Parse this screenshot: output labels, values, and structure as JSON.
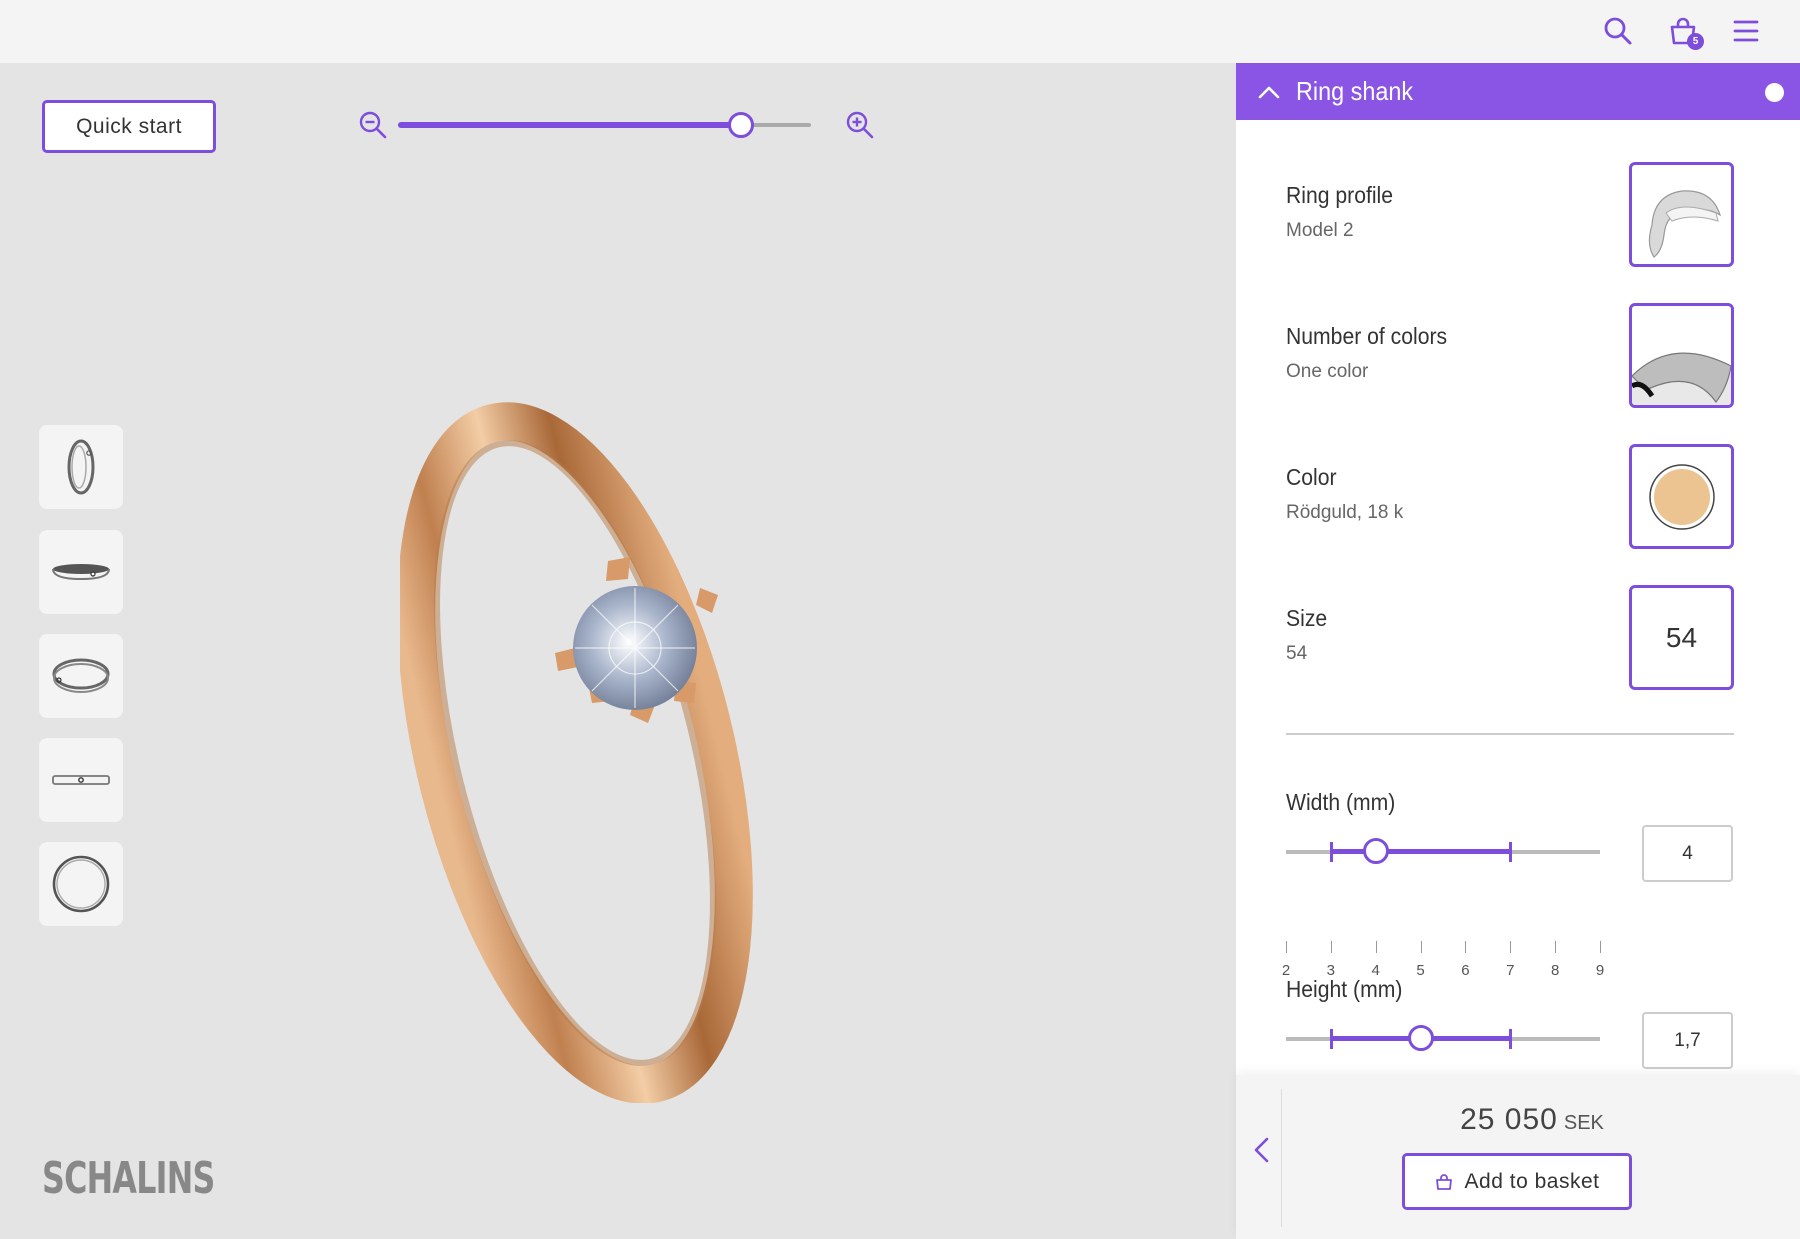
{
  "header": {
    "icons": [
      "search-icon",
      "basket-icon",
      "menu-icon"
    ],
    "basket_count": "5"
  },
  "viewer": {
    "quick_start_label": "Quick start",
    "zoom_level": 0.83,
    "view_thumbnails": [
      "side-view",
      "top-view",
      "perspective-view",
      "front-view",
      "ring-outline-view"
    ],
    "brand": "SCHALINS"
  },
  "panel": {
    "title": "Ring shank",
    "options": [
      {
        "label": "Ring profile",
        "value": "Model 2"
      },
      {
        "label": "Number of colors",
        "value": "One color"
      },
      {
        "label": "Color",
        "value": "Rödguld, 18 k",
        "swatch": "#ebc491"
      },
      {
        "label": "Size",
        "value": "54",
        "tile_text": "54"
      }
    ],
    "width": {
      "label": "Width (mm)",
      "value": "4",
      "min": 2,
      "max": 9,
      "range": [
        3,
        7
      ],
      "ticks": [
        "2",
        "3",
        "4",
        "5",
        "6",
        "7",
        "8",
        "9"
      ]
    },
    "height": {
      "label": "Height (mm)",
      "value": "1,7",
      "min": 1.0,
      "max": 2.4,
      "range": [
        1.2,
        2.0
      ],
      "current": 1.6
    },
    "price": {
      "amount": "25 050",
      "currency": "SEK"
    },
    "add_to_basket_label": "Add to basket"
  },
  "colors": {
    "accent": "#7d4ddb",
    "header": "#8a55e4",
    "rose_gold": "#c98a58"
  }
}
